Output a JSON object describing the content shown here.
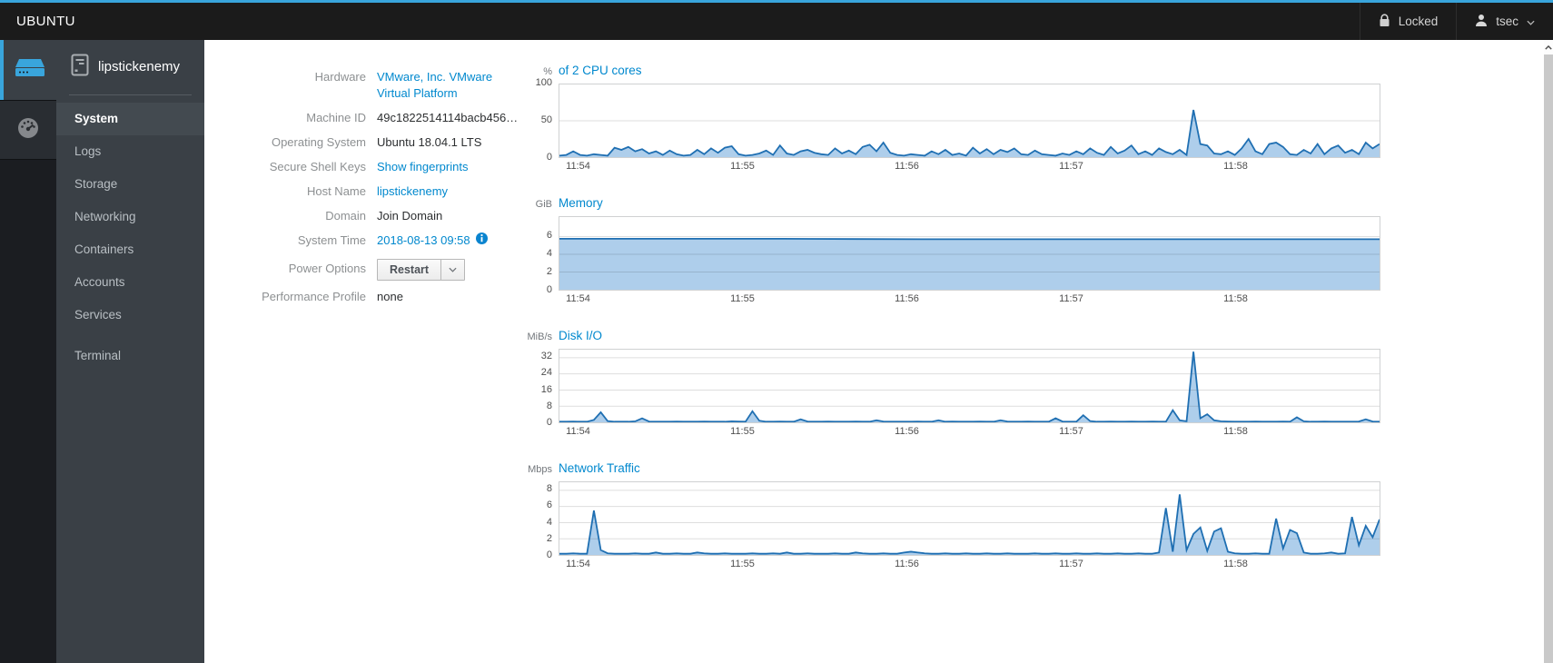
{
  "masthead": {
    "brand": "UBUNTU",
    "locked_label": "Locked",
    "user_label": "tsec"
  },
  "sidebar": {
    "hostname": "lipstickenemy",
    "items": [
      {
        "id": "system",
        "label": "System",
        "active": true
      },
      {
        "id": "logs",
        "label": "Logs"
      },
      {
        "id": "storage",
        "label": "Storage"
      },
      {
        "id": "networking",
        "label": "Networking"
      },
      {
        "id": "containers",
        "label": "Containers"
      },
      {
        "id": "accounts",
        "label": "Accounts"
      },
      {
        "id": "services",
        "label": "Services"
      },
      {
        "id": "terminal",
        "label": "Terminal",
        "gap": true
      }
    ]
  },
  "system": {
    "rows": [
      {
        "label": "Hardware",
        "value": "VMware, Inc. VMware Virtual Platform"
      },
      {
        "label": "Machine ID",
        "value": "49c1822514114bacb456…"
      },
      {
        "label": "Operating System",
        "value": "Ubuntu 18.04.1 LTS"
      },
      {
        "label": "Secure Shell Keys",
        "value": "Show fingerprints"
      },
      {
        "label": "Host Name",
        "value": "lipstickenemy"
      },
      {
        "label": "Domain",
        "value": "Join Domain"
      },
      {
        "label": "System Time",
        "value": "2018-08-13 09:58"
      },
      {
        "label": "Power Options",
        "value": "Restart"
      },
      {
        "label": "Performance Profile",
        "value": "none"
      }
    ]
  },
  "time_axis": {
    "labels": [
      "11:54",
      "11:55",
      "11:56",
      "11:57",
      "11:58"
    ],
    "fractions": [
      0.009,
      0.209,
      0.409,
      0.609,
      0.809
    ]
  },
  "chart_data": [
    {
      "type": "area",
      "unit": "%",
      "title": "of 2 CPU cores",
      "ylabel": "percent of 2 CPU cores",
      "ylim": [
        0,
        100
      ],
      "yticks": [
        0,
        50,
        100
      ],
      "x_range": [
        "11:54",
        "11:59"
      ],
      "grid": true,
      "values": [
        2,
        3,
        8,
        3,
        2,
        4,
        3,
        2,
        13,
        10,
        14,
        8,
        11,
        5,
        8,
        3,
        9,
        4,
        2,
        3,
        10,
        4,
        12,
        6,
        13,
        15,
        4,
        2,
        3,
        5,
        9,
        3,
        16,
        5,
        3,
        8,
        10,
        6,
        4,
        3,
        12,
        5,
        9,
        4,
        14,
        17,
        8,
        20,
        6,
        3,
        2,
        4,
        3,
        2,
        8,
        4,
        10,
        3,
        5,
        2,
        13,
        5,
        11,
        4,
        10,
        7,
        12,
        4,
        3,
        9,
        4,
        3,
        2,
        5,
        3,
        8,
        4,
        12,
        6,
        3,
        14,
        5,
        9,
        16,
        4,
        8,
        3,
        12,
        7,
        4,
        10,
        3,
        65,
        18,
        16,
        5,
        4,
        8,
        3,
        12,
        25,
        8,
        4,
        18,
        20,
        14,
        4,
        3,
        10,
        5,
        18,
        4,
        12,
        16,
        6,
        10,
        4,
        20,
        12,
        18
      ]
    },
    {
      "type": "area",
      "unit": "GiB",
      "title": "Memory",
      "ylabel": "GiB memory used",
      "ylim": [
        0,
        8.2
      ],
      "yticks": [
        0,
        2,
        4,
        6
      ],
      "x_range": [
        "11:54",
        "11:59"
      ],
      "grid": true,
      "values": [
        5.75,
        5.75,
        5.75,
        5.75,
        5.72,
        5.7,
        5.7,
        5.7,
        5.7,
        5.7,
        5.7,
        5.7
      ]
    },
    {
      "type": "area",
      "unit": "MiB/s",
      "title": "Disk I/O",
      "ylabel": "MiB per second disk I/O",
      "ylim": [
        0,
        36
      ],
      "yticks": [
        0,
        8,
        16,
        24,
        32
      ],
      "x_range": [
        "11:54",
        "11:59"
      ],
      "grid": true,
      "values": [
        0.3,
        0.3,
        0.4,
        0.3,
        0.3,
        1.2,
        5,
        0.6,
        0.3,
        0.3,
        0.3,
        0.5,
        2,
        0.4,
        0.3,
        0.3,
        0.3,
        0.4,
        0.3,
        0.3,
        0.3,
        0.4,
        0.3,
        0.3,
        0.3,
        0.5,
        0.4,
        0.3,
        5.5,
        0.8,
        0.3,
        0.3,
        0.4,
        0.3,
        0.3,
        1.5,
        0.4,
        0.3,
        0.3,
        0.4,
        0.3,
        0.3,
        0.3,
        0.4,
        0.3,
        0.3,
        1,
        0.4,
        0.3,
        0.3,
        0.3,
        0.3,
        0.4,
        0.3,
        0.3,
        1,
        0.3,
        0.4,
        0.3,
        0.3,
        0.3,
        0.4,
        0.3,
        0.3,
        1,
        0.4,
        0.3,
        0.3,
        0.4,
        0.3,
        0.3,
        0.3,
        2,
        0.4,
        0.3,
        0.3,
        3.5,
        0.6,
        0.3,
        0.3,
        0.4,
        0.3,
        0.3,
        0.4,
        0.3,
        0.3,
        0.4,
        0.3,
        0.3,
        6,
        1,
        0.5,
        35,
        2,
        4,
        1,
        0.5,
        0.4,
        0.3,
        0.3,
        0.3,
        0.4,
        0.3,
        0.3,
        0.3,
        0.4,
        0.3,
        2.5,
        0.5,
        0.3,
        0.3,
        0.4,
        0.3,
        0.3,
        0.3,
        0.3,
        0.4,
        1.5,
        0.4,
        0.3
      ]
    },
    {
      "type": "area",
      "unit": "Mbps",
      "title": "Network Traffic",
      "ylabel": "Mbps network traffic",
      "ylim": [
        0,
        9
      ],
      "yticks": [
        0,
        2,
        4,
        6,
        8
      ],
      "x_range": [
        "11:54",
        "11:59"
      ],
      "grid": true,
      "values": [
        0.15,
        0.15,
        0.2,
        0.15,
        0.15,
        5.5,
        0.6,
        0.2,
        0.15,
        0.15,
        0.15,
        0.2,
        0.15,
        0.15,
        0.3,
        0.15,
        0.15,
        0.2,
        0.15,
        0.15,
        0.3,
        0.2,
        0.15,
        0.15,
        0.2,
        0.15,
        0.15,
        0.15,
        0.2,
        0.15,
        0.15,
        0.2,
        0.15,
        0.3,
        0.15,
        0.15,
        0.2,
        0.15,
        0.15,
        0.15,
        0.2,
        0.15,
        0.15,
        0.3,
        0.2,
        0.15,
        0.15,
        0.2,
        0.15,
        0.15,
        0.3,
        0.4,
        0.3,
        0.2,
        0.15,
        0.15,
        0.2,
        0.15,
        0.15,
        0.2,
        0.15,
        0.15,
        0.2,
        0.15,
        0.15,
        0.2,
        0.15,
        0.15,
        0.15,
        0.2,
        0.15,
        0.15,
        0.2,
        0.15,
        0.15,
        0.2,
        0.15,
        0.15,
        0.2,
        0.15,
        0.15,
        0.2,
        0.15,
        0.15,
        0.2,
        0.15,
        0.15,
        0.3,
        5.8,
        0.4,
        7.5,
        0.6,
        2.6,
        3.4,
        0.5,
        2.9,
        3.3,
        0.4,
        0.2,
        0.15,
        0.15,
        0.2,
        0.15,
        0.15,
        4.5,
        0.8,
        3.1,
        2.7,
        0.3,
        0.15,
        0.15,
        0.2,
        0.3,
        0.15,
        0.2,
        4.7,
        1.2,
        3.6,
        2.2,
        4.4
      ]
    }
  ],
  "colors": {
    "accent": "#39a5dc",
    "link": "#0088ce",
    "chart_line": "#1f6fb2",
    "chart_fill": "rgba(160,198,232,0.85)",
    "gridline": "rgba(0,0,0,0.13)",
    "masthead_bg": "#1b1b1b",
    "sidebar_bg": "#3a4046"
  }
}
